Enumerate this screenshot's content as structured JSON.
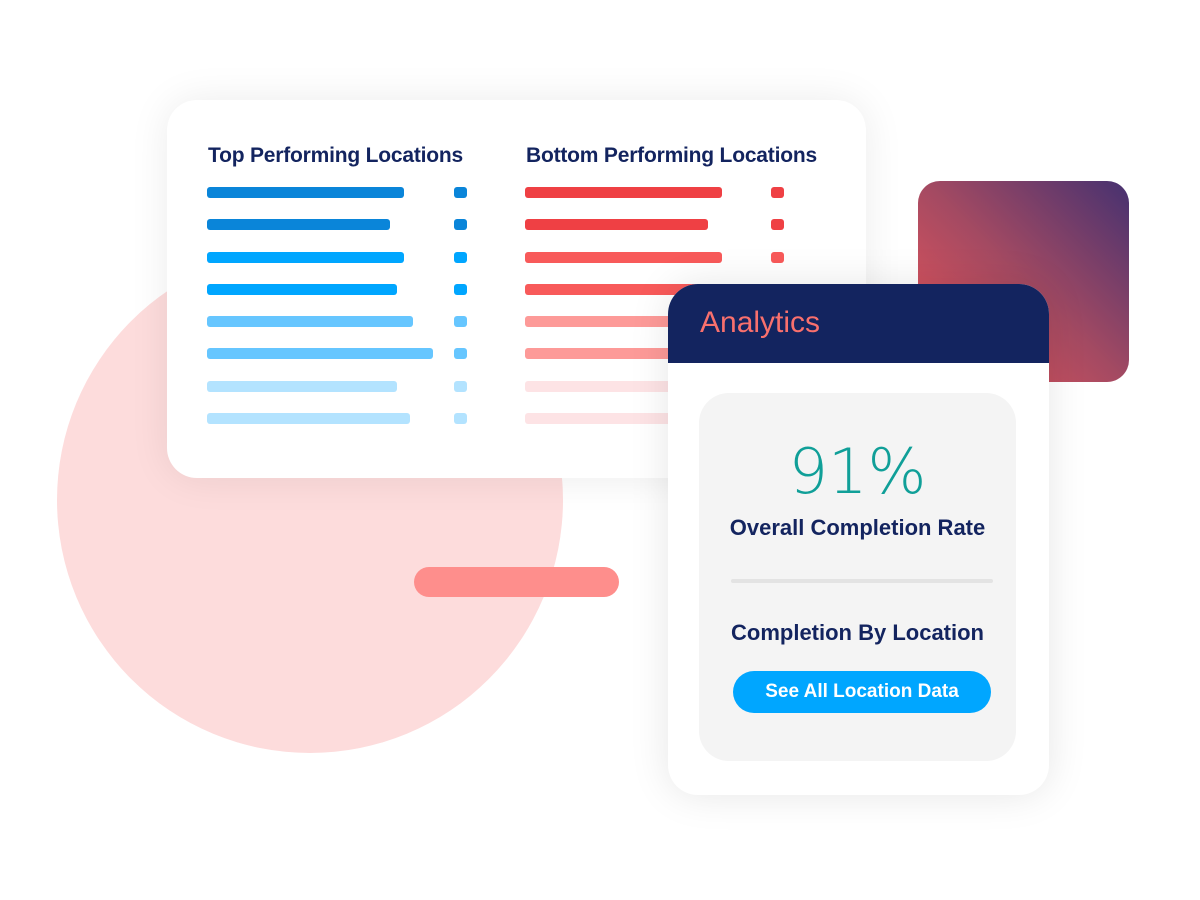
{
  "performance_card": {
    "top_title": "Top Performing Locations",
    "bottom_title": "Bottom Performing Locations",
    "top_bars": [
      {
        "level": 0.87,
        "color": "#0a85d9"
      },
      {
        "level": 0.81,
        "color": "#0a85d9"
      },
      {
        "level": 0.87,
        "color": "#00a6ff"
      },
      {
        "level": 0.84,
        "color": "#00a6ff"
      },
      {
        "level": 0.91,
        "color": "#66c6ff"
      },
      {
        "level": 1.0,
        "color": "#66c6ff"
      },
      {
        "level": 0.84,
        "color": "#b3e3ff"
      },
      {
        "level": 0.9,
        "color": "#b3e3ff"
      }
    ],
    "bottom_bars": [
      {
        "level": 0.87,
        "color": "#ef4044"
      },
      {
        "level": 0.81,
        "color": "#ef4044"
      },
      {
        "level": 0.87,
        "color": "#f85a5a"
      },
      {
        "level": 0.87,
        "color": "#f85a5a"
      },
      {
        "level": 0.87,
        "color": "#fd9a98"
      },
      {
        "level": 0.87,
        "color": "#fd9a98"
      },
      {
        "level": 0.87,
        "color": "#fde3e5"
      },
      {
        "level": 0.87,
        "color": "#fde3e5"
      }
    ]
  },
  "analytics_card": {
    "title": "Analytics",
    "completion_rate": "91%",
    "completion_label": "Overall Completion Rate",
    "by_location_label": "Completion By Location",
    "see_all_button": "See All Location Data"
  },
  "colors": {
    "navy": "#13245f",
    "accent_blue": "#00a6ff",
    "coral": "#f9706d",
    "teal": "#109f98"
  }
}
